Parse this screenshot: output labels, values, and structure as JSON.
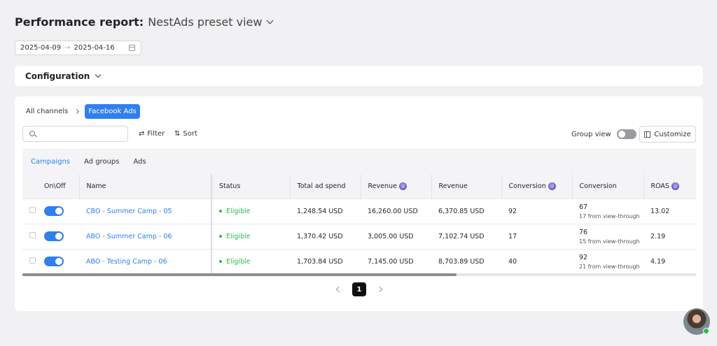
{
  "header": {
    "title": "Performance report:",
    "preset": "NestAds preset view"
  },
  "date_range": {
    "start": "2025-04-09",
    "arrow": "→",
    "end": "2025-04-16"
  },
  "configuration": {
    "label": "Configuration"
  },
  "breadcrumb": {
    "root": "All channels",
    "current": "Facebook Ads"
  },
  "toolbar": {
    "search_value": "",
    "filter_label": "Filter",
    "sort_label": "Sort",
    "group_view_label": "Group view",
    "customize_label": "Customize"
  },
  "tabs": [
    {
      "label": "Campaigns",
      "active": true
    },
    {
      "label": "Ad groups",
      "active": false
    },
    {
      "label": "Ads",
      "active": false
    }
  ],
  "table": {
    "columns": [
      "On\\Off",
      "Name",
      "Status",
      "Total ad spend",
      "Revenue",
      "Revenue",
      "Conversion",
      "Conversion",
      "ROAS"
    ],
    "rows": [
      {
        "name": "CBO - Summer Camp - 05",
        "status": "Eligible",
        "spend": "1,248.54 USD",
        "revenue_a": "16,260.00 USD",
        "revenue_b": "6,370.85 USD",
        "conv_a": "92",
        "conv_b": "67",
        "conv_b_note": "17 from view-through",
        "roas": "13.02"
      },
      {
        "name": "ABO - Summer Camp - 06",
        "status": "Eligible",
        "spend": "1,370.42 USD",
        "revenue_a": "3,005.00 USD",
        "revenue_b": "7,102.74 USD",
        "conv_a": "17",
        "conv_b": "76",
        "conv_b_note": "15 from view-through",
        "roas": "2.19"
      },
      {
        "name": "ABO - Testing Camp - 06",
        "status": "Eligible",
        "spend": "1,703.84 USD",
        "revenue_a": "7,145.00 USD",
        "revenue_b": "8,703.89 USD",
        "conv_a": "40",
        "conv_b": "92",
        "conv_b_note": "21 from view-through",
        "roas": "4.19"
      }
    ]
  },
  "pagination": {
    "current_page": "1"
  },
  "colors": {
    "accent": "#2f80ed",
    "eligible": "#2eb84f",
    "info_badge": "#6c63c7"
  }
}
